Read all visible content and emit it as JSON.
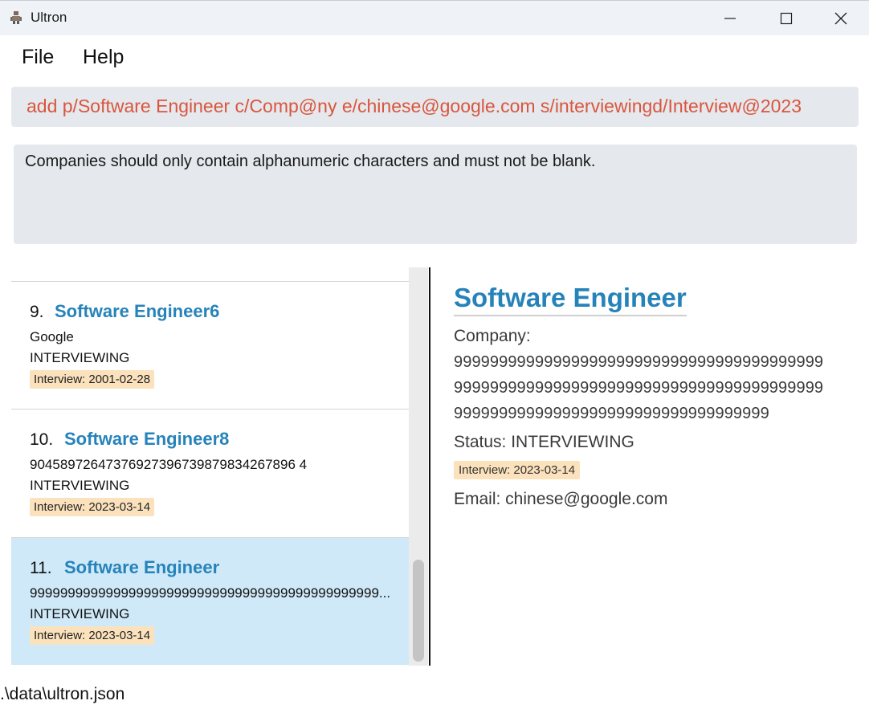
{
  "window": {
    "title": "Ultron",
    "controls": {
      "minimize_icon": "minimize-icon",
      "maximize_icon": "maximize-icon",
      "close_icon": "close-icon"
    }
  },
  "menu": {
    "items": [
      "File",
      "Help"
    ]
  },
  "command_box": {
    "value": "add p/Software Engineer c/Comp@ny e/chinese@google.com s/interviewingd/Interview@2023",
    "text_color": "#d9563f"
  },
  "result_box": {
    "message": "Companies should only contain alphanumeric characters and must not be blank."
  },
  "list": {
    "cards": [
      {
        "index": "9.",
        "role": "Software Engineer6",
        "company": "Google",
        "status": "INTERVIEWING",
        "tag": "Interview: 2001-02-28",
        "selected": false
      },
      {
        "index": "10.",
        "role": "Software Engineer8",
        "company": "90458972647376927396739879834267896 4",
        "status": "INTERVIEWING",
        "tag": "Interview: 2023-03-14",
        "selected": false
      },
      {
        "index": "11.",
        "role": "Software Engineer",
        "company": "9999999999999999999999999999999999999999999999...",
        "status": "INTERVIEWING",
        "tag": "Interview: 2023-03-14",
        "selected": true
      }
    ],
    "accent_color": "#2683ba",
    "selected_color": "#cfe9f8",
    "tag_color": "#fbe2bd"
  },
  "detail": {
    "title": "Software Engineer",
    "company_label": "Company:",
    "company_lines": [
      "99999999999999999999999999999999999999999",
      "99999999999999999999999999999999999999999",
      "99999999999999999999999999999999999"
    ],
    "status": "Status: INTERVIEWING",
    "tag": "Interview: 2023-03-14",
    "email": "Email: chinese@google.com"
  },
  "status_bar": {
    "path": ".\\data\\ultron.json"
  }
}
